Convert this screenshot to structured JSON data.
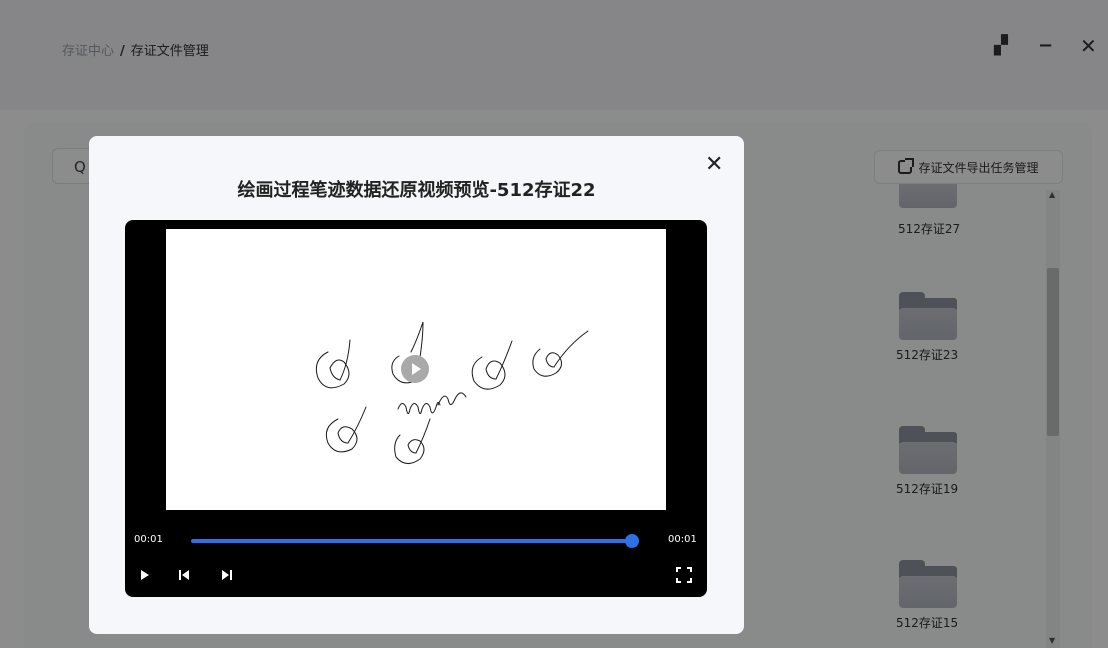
{
  "breadcrumb": {
    "root": "存证中心",
    "separator": "/",
    "current": "存证文件管理"
  },
  "window_controls": {
    "restore": "▞",
    "minimize": "−",
    "close": "✕"
  },
  "toolbar": {
    "search_icon": "Q",
    "export_button_label": "存证文件导出任务管理"
  },
  "folders": [
    {
      "name": "512存证27"
    },
    {
      "name": "512存证23"
    },
    {
      "name": "512存证19"
    },
    {
      "name": "512存证15"
    }
  ],
  "modal": {
    "title": "绘画过程笔迹数据还原视频预览-512存证22",
    "close_icon": "✕",
    "player": {
      "current_time": "00:01",
      "duration": "00:01",
      "progress": 1.0
    }
  }
}
